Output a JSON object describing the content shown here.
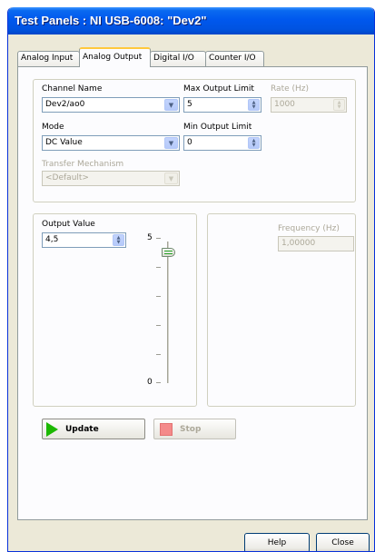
{
  "window": {
    "title": "Test Panels : NI USB-6008: \"Dev2\""
  },
  "tabs": [
    {
      "label": "Analog Input"
    },
    {
      "label": "Analog Output"
    },
    {
      "label": "Digital I/O"
    },
    {
      "label": "Counter I/O"
    }
  ],
  "config": {
    "channel_name_label": "Channel Name",
    "channel_name_value": "Dev2/ao0",
    "max_limit_label": "Max Output Limit",
    "max_limit_value": "5",
    "rate_label": "Rate (Hz)",
    "rate_value": "1000",
    "mode_label": "Mode",
    "mode_value": "DC Value",
    "min_limit_label": "Min Output Limit",
    "min_limit_value": "0",
    "transfer_label": "Transfer Mechanism",
    "transfer_value": "<Default>"
  },
  "output": {
    "value_label": "Output Value",
    "value": "4,5",
    "slider_max_label": "5",
    "slider_min_label": "0",
    "slider_level_fraction": 0.9
  },
  "frequency": {
    "label": "Frequency (Hz)",
    "value": "1,00000"
  },
  "actions": {
    "update_label": "Update",
    "stop_label": "Stop",
    "help_label": "Help",
    "close_label": "Close"
  },
  "colors": {
    "titlebar": "#0058ee",
    "update_icon": "#1cb800",
    "stop_icon": "#f48a8a",
    "active_tab_highlight": "#ffc83c"
  }
}
